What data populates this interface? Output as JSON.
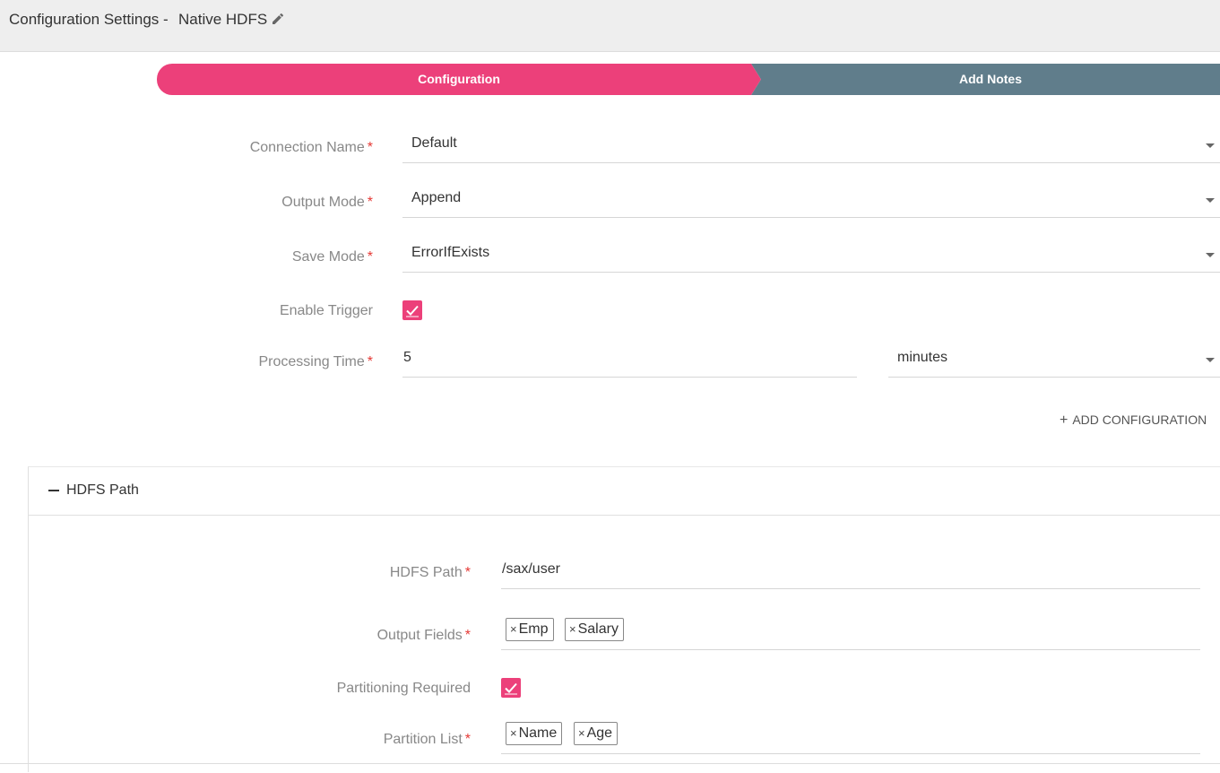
{
  "header": {
    "title": "Configuration Settings -",
    "name": "Native HDFS"
  },
  "stepper": {
    "steps": [
      {
        "label": "Configuration",
        "active": true
      },
      {
        "label": "Add Notes",
        "active": false
      }
    ]
  },
  "form": {
    "connection_name": {
      "label": "Connection Name",
      "value": "Default"
    },
    "output_mode": {
      "label": "Output Mode",
      "value": "Append"
    },
    "save_mode": {
      "label": "Save Mode",
      "value": "ErrorIfExists"
    },
    "enable_trigger": {
      "label": "Enable Trigger",
      "checked": true
    },
    "processing_time": {
      "label": "Processing Time",
      "value": "5",
      "unit": "minutes"
    },
    "required_mark": "*",
    "add_configuration": "ADD CONFIGURATION"
  },
  "hdfs_panel": {
    "title": "HDFS Path",
    "hdfs_path": {
      "label": "HDFS Path",
      "value": "/sax/user"
    },
    "output_fields": {
      "label": "Output Fields",
      "tags": [
        "Emp",
        "Salary"
      ]
    },
    "partitioning_required": {
      "label": "Partitioning Required",
      "checked": true
    },
    "partition_list": {
      "label": "Partition List",
      "tags": [
        "Name",
        "Age"
      ]
    },
    "remove_glyph": "×"
  },
  "colors": {
    "accent": "#ec407a",
    "step_inactive": "#607d8b",
    "required": "#e53935"
  }
}
